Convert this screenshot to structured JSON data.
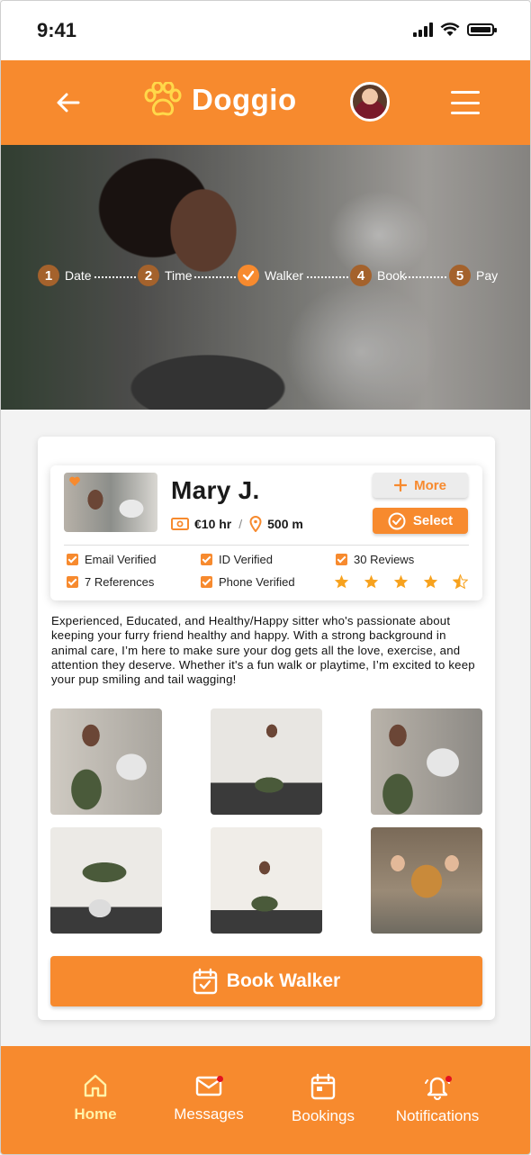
{
  "status": {
    "time": "9:41"
  },
  "header": {
    "app_name": "Doggio"
  },
  "steps": [
    {
      "num": "1",
      "label": "Date",
      "state": "pending"
    },
    {
      "num": "2",
      "label": "Time",
      "state": "pending"
    },
    {
      "num": "",
      "label": "Walker",
      "state": "done"
    },
    {
      "num": "4",
      "label": "Book",
      "state": "pending"
    },
    {
      "num": "5",
      "label": "Pay",
      "state": "pending"
    }
  ],
  "profile": {
    "name": "Mary J.",
    "price": "€10 hr",
    "separator": "/",
    "distance": "500 m",
    "more_label": "More",
    "select_label": "Select",
    "badges": [
      "Email Verified",
      "ID Verified",
      "30 Reviews",
      "7 References",
      "Phone Verified"
    ],
    "rating": 4.5,
    "description": "Experienced, Educated, and Healthy/Happy sitter who's passionate about keeping your furry friend healthy and happy. With a strong background in animal care, I’m here to make sure your dog gets all the love, exercise, and attention they deserve. Whether it's a fun walk or playtime, I’m excited to keep your pup smiling and tail wagging!"
  },
  "book_button": "Book Walker",
  "nav": [
    {
      "label": "Home",
      "active": true
    },
    {
      "label": "Messages",
      "active": false
    },
    {
      "label": "Bookings",
      "active": false
    },
    {
      "label": "Notifications",
      "active": false
    }
  ],
  "colors": {
    "accent": "#f78a2e",
    "active_nav": "#fff2a8",
    "dot": "#e3121f"
  }
}
